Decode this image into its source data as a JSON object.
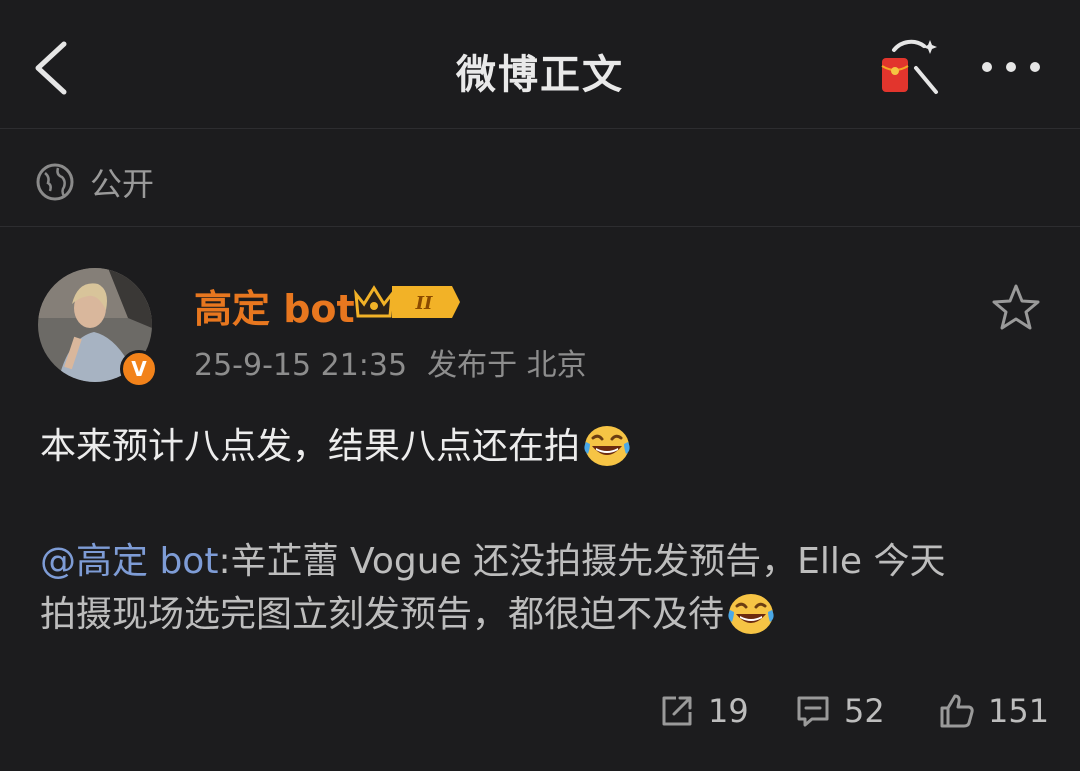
{
  "header": {
    "title": "微博正文",
    "back_icon": "chevron-left-icon",
    "redpacket_icon": "red-packet-icon",
    "more_icon": "more-dots-icon"
  },
  "visibility": {
    "label": "公开",
    "icon": "globe-icon"
  },
  "author": {
    "name": "高定 bot",
    "badge_icon": "crown-level-badge-icon",
    "badge_text": "II",
    "verified": "V",
    "time": "25-9-15 21:35",
    "location": "发布于 北京"
  },
  "post": {
    "text": "本来预计八点发，结果八点还在拍"
  },
  "quote": {
    "mention": "@高定 bot",
    "line1": ":辛芷蕾 Vogue 还没拍摄先发预告，Elle 今天",
    "line2": "拍摄现场选完图立刻发预告，都很迫不及待"
  },
  "actions": {
    "repost": "19",
    "comment": "52",
    "like": "151"
  },
  "colors": {
    "background": "#1c1c1e",
    "username": "#e8771f",
    "mention": "#7e9cd6"
  }
}
